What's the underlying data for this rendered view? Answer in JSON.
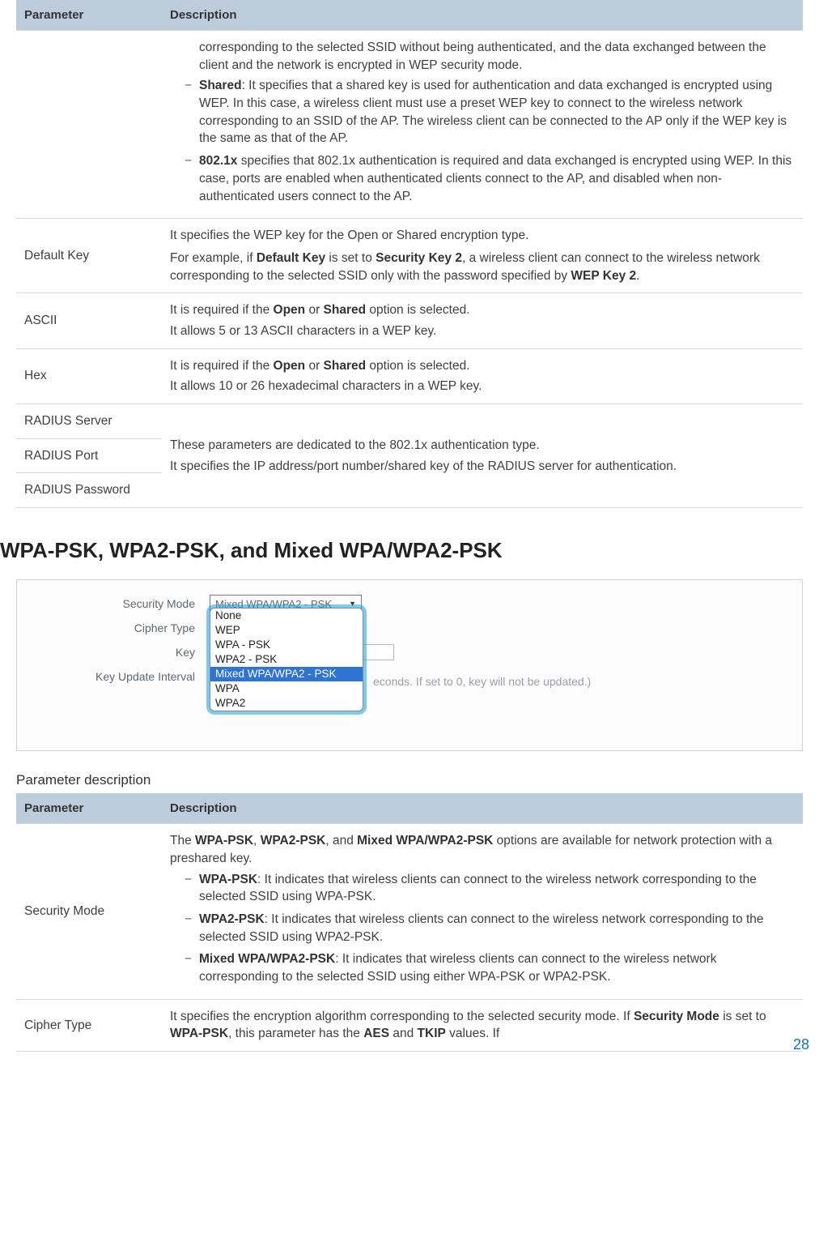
{
  "table1": {
    "header_param": "Parameter",
    "header_desc": "Description",
    "row0": {
      "d_prefix": "corresponding to the selected SSID without being authenticated, and the data exchanged between the client and the network is encrypted in WEP security mode.",
      "li_shared_pre": "Shared",
      "li_shared": ": It specifies that a shared key is used for authentication and data exchanged is encrypted using WEP. In this case, a wireless client must use a preset WEP key to connect to the wireless network corresponding to an SSID of the AP. The wireless client can be connected to the AP only if the WEP key is the same as that of the AP.",
      "li_8021x_pre": "802.1x",
      "li_8021x": " specifies that 802.1x authentication is required and data exchanged is encrypted using WEP. In this case, ports are enabled when authenticated clients connect to the AP, and disabled when non-authenticated users connect to the AP."
    },
    "row_defaultkey": {
      "param": "Default Key",
      "p1": "It specifies the WEP key for the Open or Shared encryption type.",
      "p2a": "For example, if ",
      "p2b": "Default Key",
      "p2c": " is set to ",
      "p2d": "Security Key 2",
      "p2e": ", a wireless client can connect to the wireless network corresponding to the selected SSID only with the password specified by ",
      "p2f": "WEP Key 2",
      "p2g": "."
    },
    "row_ascii": {
      "param": "ASCII",
      "p1a": "It is required if the ",
      "p1b": "Open",
      "p1c": " or ",
      "p1d": "Shared",
      "p1e": " option is selected.",
      "p2": "It allows 5 or 13 ASCII characters in a WEP key."
    },
    "row_hex": {
      "param": "Hex",
      "p1a": "It is required if the ",
      "p1b": "Open",
      "p1c": " or ",
      "p1d": "Shared",
      "p1e": " option is selected.",
      "p2": "It allows 10 or 26 hexadecimal characters in a WEP key."
    },
    "row_radius": {
      "p_server": "RADIUS Server",
      "p_port": "RADIUS Port",
      "p_pass": "RADIUS Password",
      "d1": "These parameters are dedicated to the 802.1x authentication type.",
      "d2": "It specifies the IP address/port number/shared key of the RADIUS server for authentication."
    }
  },
  "section_title": "WPA-PSK, WPA2-PSK, and Mixed WPA/WPA2-PSK",
  "screenshot": {
    "label_secmode": "Security Mode",
    "label_cipher": "Cipher Type",
    "label_key": "Key",
    "label_interval": "Key Update Interval",
    "select_current": "Mixed WPA/WPA2 - PSK",
    "dd": [
      "None",
      "WEP",
      "WPA - PSK",
      "WPA2 - PSK",
      "Mixed WPA/WPA2 - PSK",
      "WPA",
      "WPA2"
    ],
    "hint_visible": "econds. If set to 0, key will not be updated.)"
  },
  "caption2": "Parameter description",
  "table2": {
    "header_param": "Parameter",
    "header_desc": "Description",
    "row_secmode": {
      "param": "Security Mode",
      "intro_a": "The ",
      "intro_b": "WPA-PSK",
      "intro_c": ", ",
      "intro_d": "WPA2-PSK",
      "intro_e": ", and ",
      "intro_f": "Mixed WPA/WPA2-PSK",
      "intro_g": " options are available for network protection with a preshared key.",
      "li1_pre": "WPA-PSK",
      "li1": ": It indicates that wireless clients can connect to the wireless network corresponding to the selected SSID using WPA-PSK.",
      "li2_pre": "WPA2-PSK",
      "li2": ": It indicates that wireless clients can connect to the wireless network corresponding to the selected SSID using WPA2-PSK.",
      "li3_pre": "Mixed WPA/WPA2-PSK",
      "li3": ": It indicates that wireless clients can connect to the wireless network corresponding to the selected SSID using either WPA-PSK or WPA2-PSK."
    },
    "row_cipher": {
      "param": "Cipher Type",
      "d_a": "It specifies the encryption algorithm corresponding to the selected security mode. If ",
      "d_b": "Security Mode",
      "d_c": " is set to ",
      "d_d": "WPA-PSK",
      "d_e": ", this parameter has the ",
      "d_f": "AES",
      "d_g": " and ",
      "d_h": "TKIP",
      "d_i": " values. If"
    }
  },
  "pagenum": "28"
}
